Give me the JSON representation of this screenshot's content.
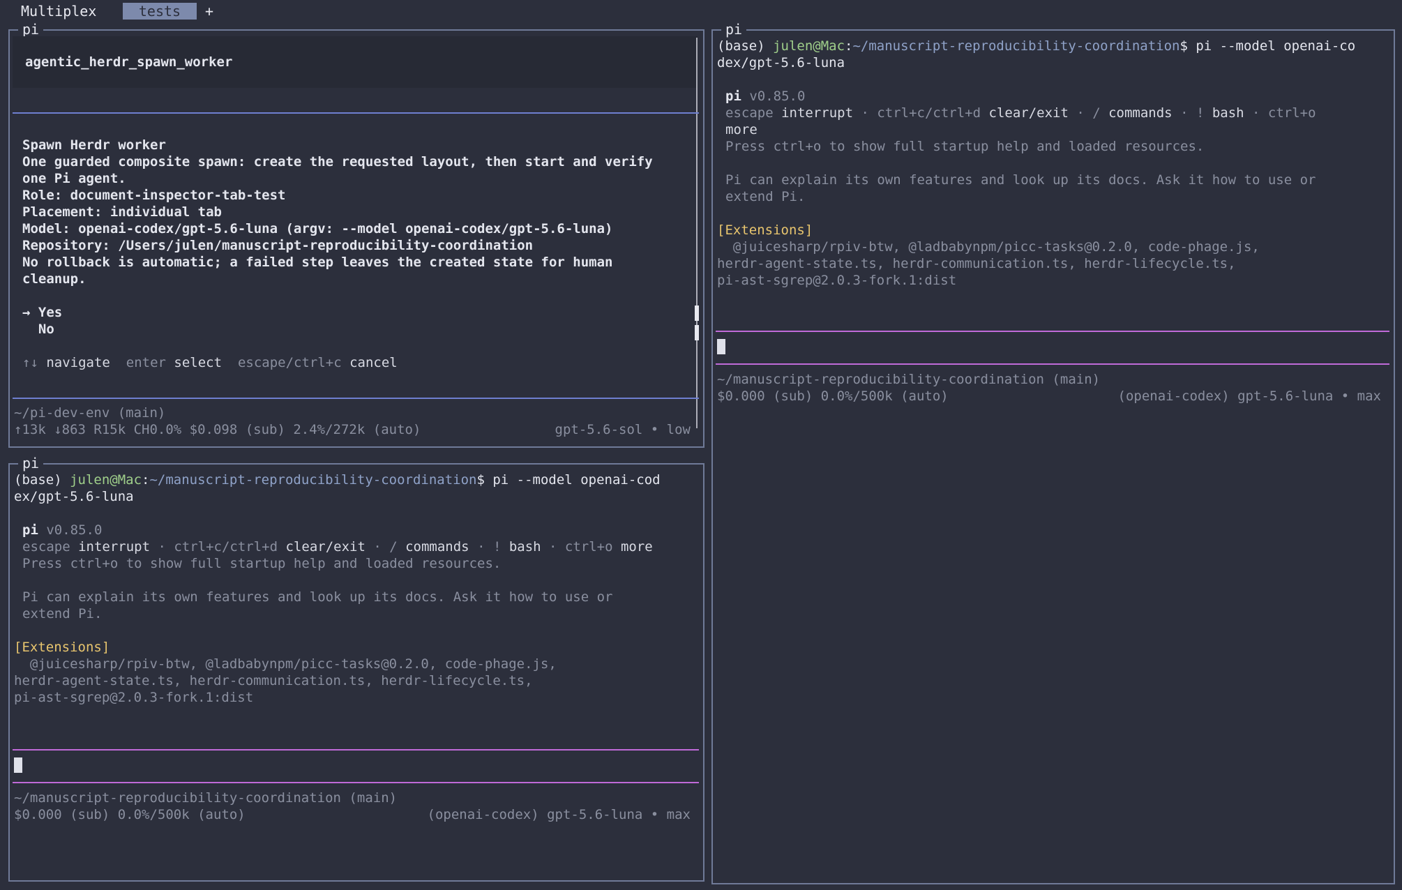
{
  "tabbar": {
    "app_title": "Multiplex",
    "tabs": [
      {
        "label": "tests",
        "active": true
      }
    ],
    "add_label": "+"
  },
  "panes": [
    {
      "title": "pi",
      "tool_name": "agentic_herdr_spawn_worker",
      "dialog": {
        "heading": "Spawn Herdr worker",
        "lines": [
          "One guarded composite spawn: create the requested layout, then start and verify",
          "one Pi agent.",
          "Role: document-inspector-tab-test",
          "Placement: individual tab",
          "Model: openai-codex/gpt-5.6-luna (argv: --model openai-codex/gpt-5.6-luna)",
          "Repository: /Users/julen/manuscript-reproducibility-coordination",
          "No rollback is automatic; a failed step leaves the created state for human",
          "cleanup."
        ],
        "options": [
          {
            "label": "Yes",
            "selected": true,
            "marker": "→"
          },
          {
            "label": "No",
            "selected": false
          }
        ],
        "hints": [
          {
            "key": "↑↓",
            "action": "navigate"
          },
          {
            "key": "enter",
            "action": "select"
          },
          {
            "key": "escape/ctrl+c",
            "action": "cancel"
          }
        ]
      },
      "footer": {
        "path": "~/pi-dev-env (main)",
        "stats": "↑13k ↓863 R15k CH0.0% $0.098 (sub) 2.4%/272k (auto)",
        "model": "gpt-5.6-sol • low"
      }
    },
    {
      "title": "pi",
      "prompt": {
        "env": "(base) ",
        "user": "julen@Mac",
        "colon": ":",
        "cwd": "~/manuscript-reproducibility-coordination",
        "command_first": "$ pi --model openai-cod",
        "command_wrap": "ex/gpt-5.6-luna"
      },
      "banner": {
        "name": "pi",
        "version": " v0.85.0",
        "keys_lines": [
          [
            {
              "t": "escape",
              "s": "dim"
            },
            {
              "t": " interrupt",
              "s": "hi"
            },
            {
              "t": " · ctrl+c/ctrl+d",
              "s": "dim"
            },
            {
              "t": " clear/exit",
              "s": "hi"
            },
            {
              "t": " · / ",
              "s": "dim"
            },
            {
              "t": "commands",
              "s": "hi"
            },
            {
              "t": " · ! ",
              "s": "dim"
            },
            {
              "t": "bash",
              "s": "hi"
            },
            {
              "t": " · ctrl+o ",
              "s": "dim"
            },
            {
              "t": "more",
              "s": "hi"
            }
          ]
        ],
        "help": "Press ctrl+o to show full startup help and loaded resources.",
        "explain_lines": [
          "Pi can explain its own features and look up its docs. Ask it how to use or",
          "extend Pi."
        ]
      },
      "extensions": {
        "header": "[Extensions]",
        "lines": [
          "  @juicesharp/rpiv-btw, @ladbabynpm/picc-tasks@0.2.0, code-phage.js,",
          "herdr-agent-state.ts, herdr-communication.ts, herdr-lifecycle.ts,",
          "pi-ast-sgrep@2.0.3-fork.1:dist"
        ]
      },
      "footer": {
        "path": "~/manuscript-reproducibility-coordination (main)",
        "stats": "$0.000 (sub) 0.0%/500k (auto)",
        "model": "(openai-codex) gpt-5.6-luna • max"
      }
    },
    {
      "title": "pi",
      "prompt": {
        "env": "(base) ",
        "user": "julen@Mac",
        "colon": ":",
        "cwd": "~/manuscript-reproducibility-coordination",
        "command_first": "$ pi --model openai-co",
        "command_wrap": "dex/gpt-5.6-luna"
      },
      "banner": {
        "name": "pi",
        "version": " v0.85.0",
        "keys_lines": [
          [
            {
              "t": "escape",
              "s": "dim"
            },
            {
              "t": " interrupt",
              "s": "hi"
            },
            {
              "t": " · ctrl+c/ctrl+d",
              "s": "dim"
            },
            {
              "t": " clear/exit",
              "s": "hi"
            },
            {
              "t": " · / ",
              "s": "dim"
            },
            {
              "t": "commands",
              "s": "hi"
            },
            {
              "t": " · ! ",
              "s": "dim"
            },
            {
              "t": "bash",
              "s": "hi"
            },
            {
              "t": " · ctrl+o",
              "s": "dim"
            }
          ],
          [
            {
              "t": "more",
              "s": "hi"
            }
          ]
        ],
        "help": "Press ctrl+o to show full startup help and loaded resources.",
        "explain_lines": [
          "Pi can explain its own features and look up its docs. Ask it how to use or",
          "extend Pi."
        ]
      },
      "extensions": {
        "header": "[Extensions]",
        "lines": [
          "  @juicesharp/rpiv-btw, @ladbabynpm/picc-tasks@0.2.0, code-phage.js,",
          "herdr-agent-state.ts, herdr-communication.ts, herdr-lifecycle.ts,",
          "pi-ast-sgrep@2.0.3-fork.1:dist"
        ]
      },
      "footer": {
        "path": "~/manuscript-reproducibility-coordination (main)",
        "stats": "$0.000 (sub) 0.0%/500k (auto)",
        "model": "(openai-codex) gpt-5.6-luna • max"
      }
    }
  ]
}
